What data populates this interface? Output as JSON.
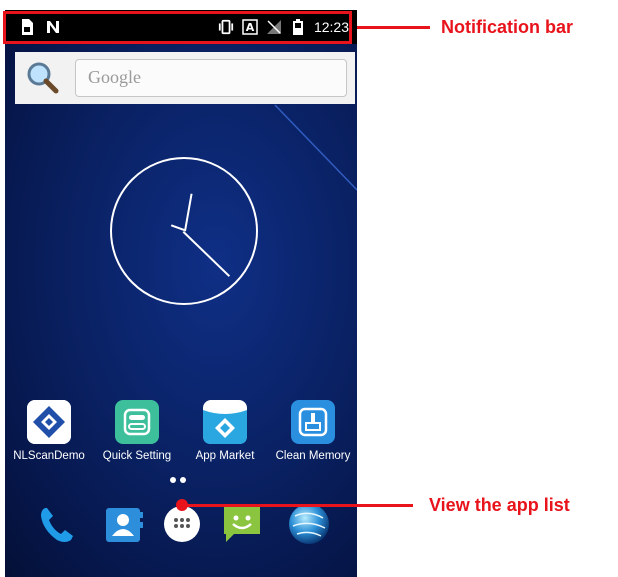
{
  "status_bar": {
    "time": "12:23",
    "icons": [
      "sim-card-icon",
      "nfc-icon",
      "vibrate-icon",
      "input-method-a-icon",
      "no-signal-icon",
      "battery-icon"
    ]
  },
  "search": {
    "placeholder": "Google",
    "icon": "magnifier-icon"
  },
  "clock": {
    "style": "analog",
    "shows": "12:23"
  },
  "home_apps": [
    {
      "label": "NLScanDemo",
      "icon": "nlscan-demo-icon"
    },
    {
      "label": "Quick Setting",
      "icon": "quick-setting-icon"
    },
    {
      "label": "App Market",
      "icon": "app-market-icon"
    },
    {
      "label": "Clean Memory",
      "icon": "clean-memory-icon"
    }
  ],
  "dock": [
    {
      "icon": "phone-icon"
    },
    {
      "icon": "contacts-icon"
    },
    {
      "icon": "app-drawer-icon"
    },
    {
      "icon": "messaging-icon"
    },
    {
      "icon": "browser-globe-icon"
    }
  ],
  "annotations": {
    "notification_bar": "Notification bar",
    "app_list": "View the app list"
  },
  "colors": {
    "annotation_red": "#e8131b",
    "wallpaper_blue": "#0a2265"
  }
}
